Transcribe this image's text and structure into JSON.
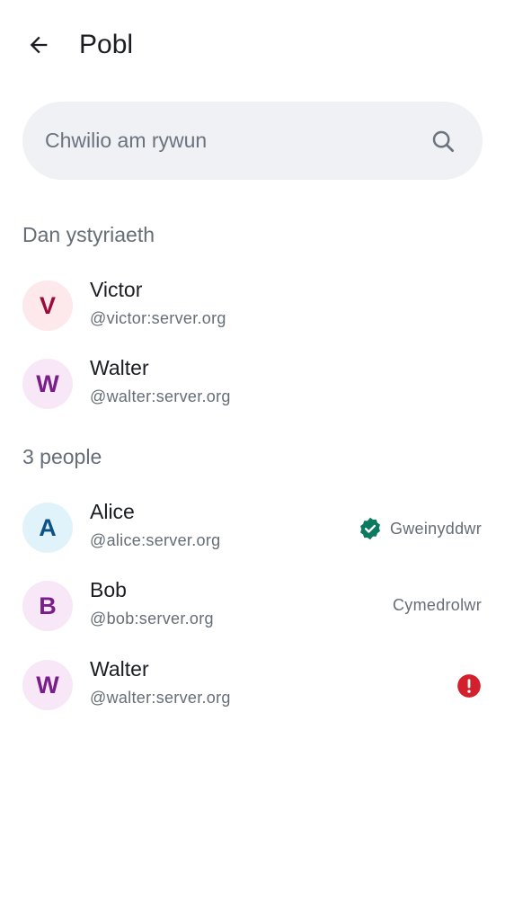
{
  "header": {
    "title": "Pobl",
    "back_icon": "arrow-left-icon"
  },
  "search": {
    "placeholder": "Chwilio am rywun",
    "value": "",
    "icon": "search-icon"
  },
  "sections": [
    {
      "title": "Dan ystyriaeth",
      "members": [
        {
          "initial": "V",
          "name": "Victor",
          "user_id": "@victor:server.org",
          "avatar_bg": "#fde8ec",
          "avatar_fg": "#9b0a3d"
        },
        {
          "initial": "W",
          "name": "Walter",
          "user_id": "@walter:server.org",
          "avatar_bg": "#f8e8f7",
          "avatar_fg": "#7a1e8a"
        }
      ]
    },
    {
      "title": "3 people",
      "members": [
        {
          "initial": "A",
          "name": "Alice",
          "user_id": "@alice:server.org",
          "avatar_bg": "#e1f3fa",
          "avatar_fg": "#0a5287",
          "role": "Gweinyddwr",
          "role_icon": "verified-badge-icon"
        },
        {
          "initial": "B",
          "name": "Bob",
          "user_id": "@bob:server.org",
          "avatar_bg": "#f8e8f7",
          "avatar_fg": "#7a1e8a",
          "role": "Cymedrolwr"
        },
        {
          "initial": "W",
          "name": "Walter",
          "user_id": "@walter:server.org",
          "avatar_bg": "#f8e8f7",
          "avatar_fg": "#7a1e8a",
          "status_icon": "error-icon"
        }
      ]
    }
  ],
  "colors": {
    "verified": "#0b7a5e",
    "error": "#d3202d",
    "search_bg": "#eff1f5"
  }
}
